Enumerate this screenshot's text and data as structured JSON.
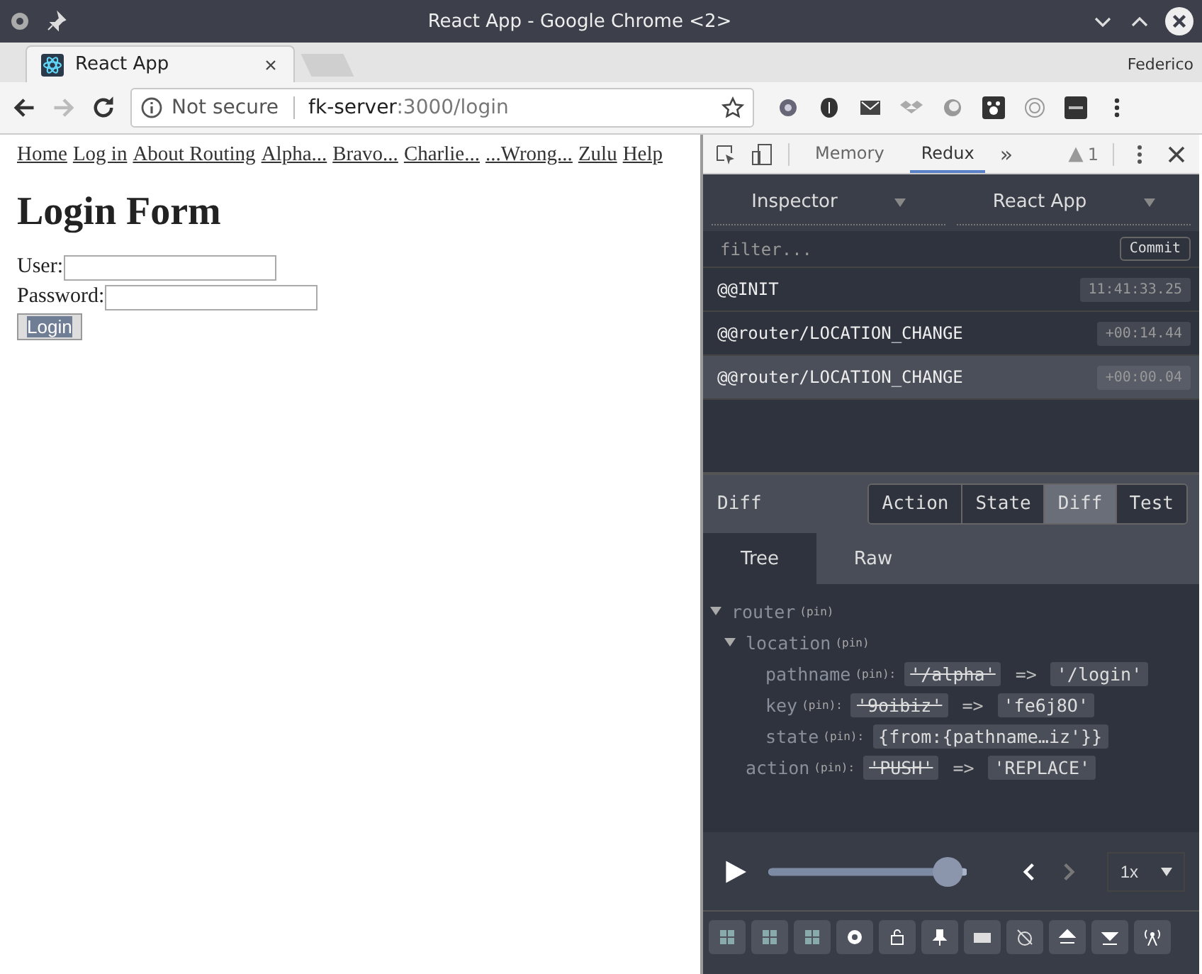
{
  "window": {
    "title": "React App - Google Chrome <2>"
  },
  "browser_tabs": [
    {
      "label": "React App",
      "selected": true
    }
  ],
  "profile": "Federico",
  "address_bar": {
    "security": "Not secure",
    "host": "fk-server",
    "path": ":3000/login"
  },
  "page": {
    "nav_links": [
      "Home",
      "Log in",
      "About Routing",
      "Alpha...",
      "Bravo...",
      "Charlie...",
      "...Wrong...",
      "Zulu",
      "Help"
    ],
    "heading": "Login Form",
    "fields": [
      {
        "label": "User:"
      },
      {
        "label": "Password:"
      }
    ],
    "button": "Login"
  },
  "devtools": {
    "tabs": [
      {
        "label": "Memory",
        "selected": false
      },
      {
        "label": "Redux",
        "selected": true
      }
    ],
    "overflow": "»",
    "warnings": "1",
    "monitor": "Inspector",
    "instance": "React App",
    "filter": {
      "placeholder": "filter..."
    },
    "commit": "Commit",
    "actions": [
      {
        "name": "@@INIT",
        "time": "11:41:33.25",
        "selected": false
      },
      {
        "name": "@@router/LOCATION_CHANGE",
        "time": "+00:14.44",
        "selected": false
      },
      {
        "name": "@@router/LOCATION_CHANGE",
        "time": "+00:00.04",
        "selected": true
      }
    ],
    "panel_title": "Diff",
    "panel_tabs": [
      {
        "label": "Action",
        "selected": false
      },
      {
        "label": "State",
        "selected": false
      },
      {
        "label": "Diff",
        "selected": true
      },
      {
        "label": "Test",
        "selected": false
      }
    ],
    "view_tabs": [
      {
        "label": "Tree",
        "selected": true
      },
      {
        "label": "Raw",
        "selected": false
      }
    ],
    "tree": [
      {
        "key": "router",
        "pin": "(pin)",
        "expanded": true,
        "children": [
          {
            "key": "location",
            "pin": "(pin)",
            "expanded": true,
            "children": [
              {
                "key": "pathname",
                "pin": "(pin):",
                "old": "'/alpha'",
                "arrow": "=>",
                "new": "'/login'"
              },
              {
                "key": "key",
                "pin": "(pin):",
                "old": "'9oibiz'",
                "arrow": "=>",
                "new": "'fe6j8O'"
              },
              {
                "key": "state",
                "pin": "(pin):",
                "value": "{from:{pathname…iz'}}"
              }
            ]
          },
          {
            "key": "action",
            "pin": "(pin):",
            "old": "'PUSH'",
            "arrow": "=>",
            "new": "'REPLACE'"
          }
        ]
      }
    ],
    "slider": {
      "level": 0.97
    },
    "speed": "1x"
  }
}
